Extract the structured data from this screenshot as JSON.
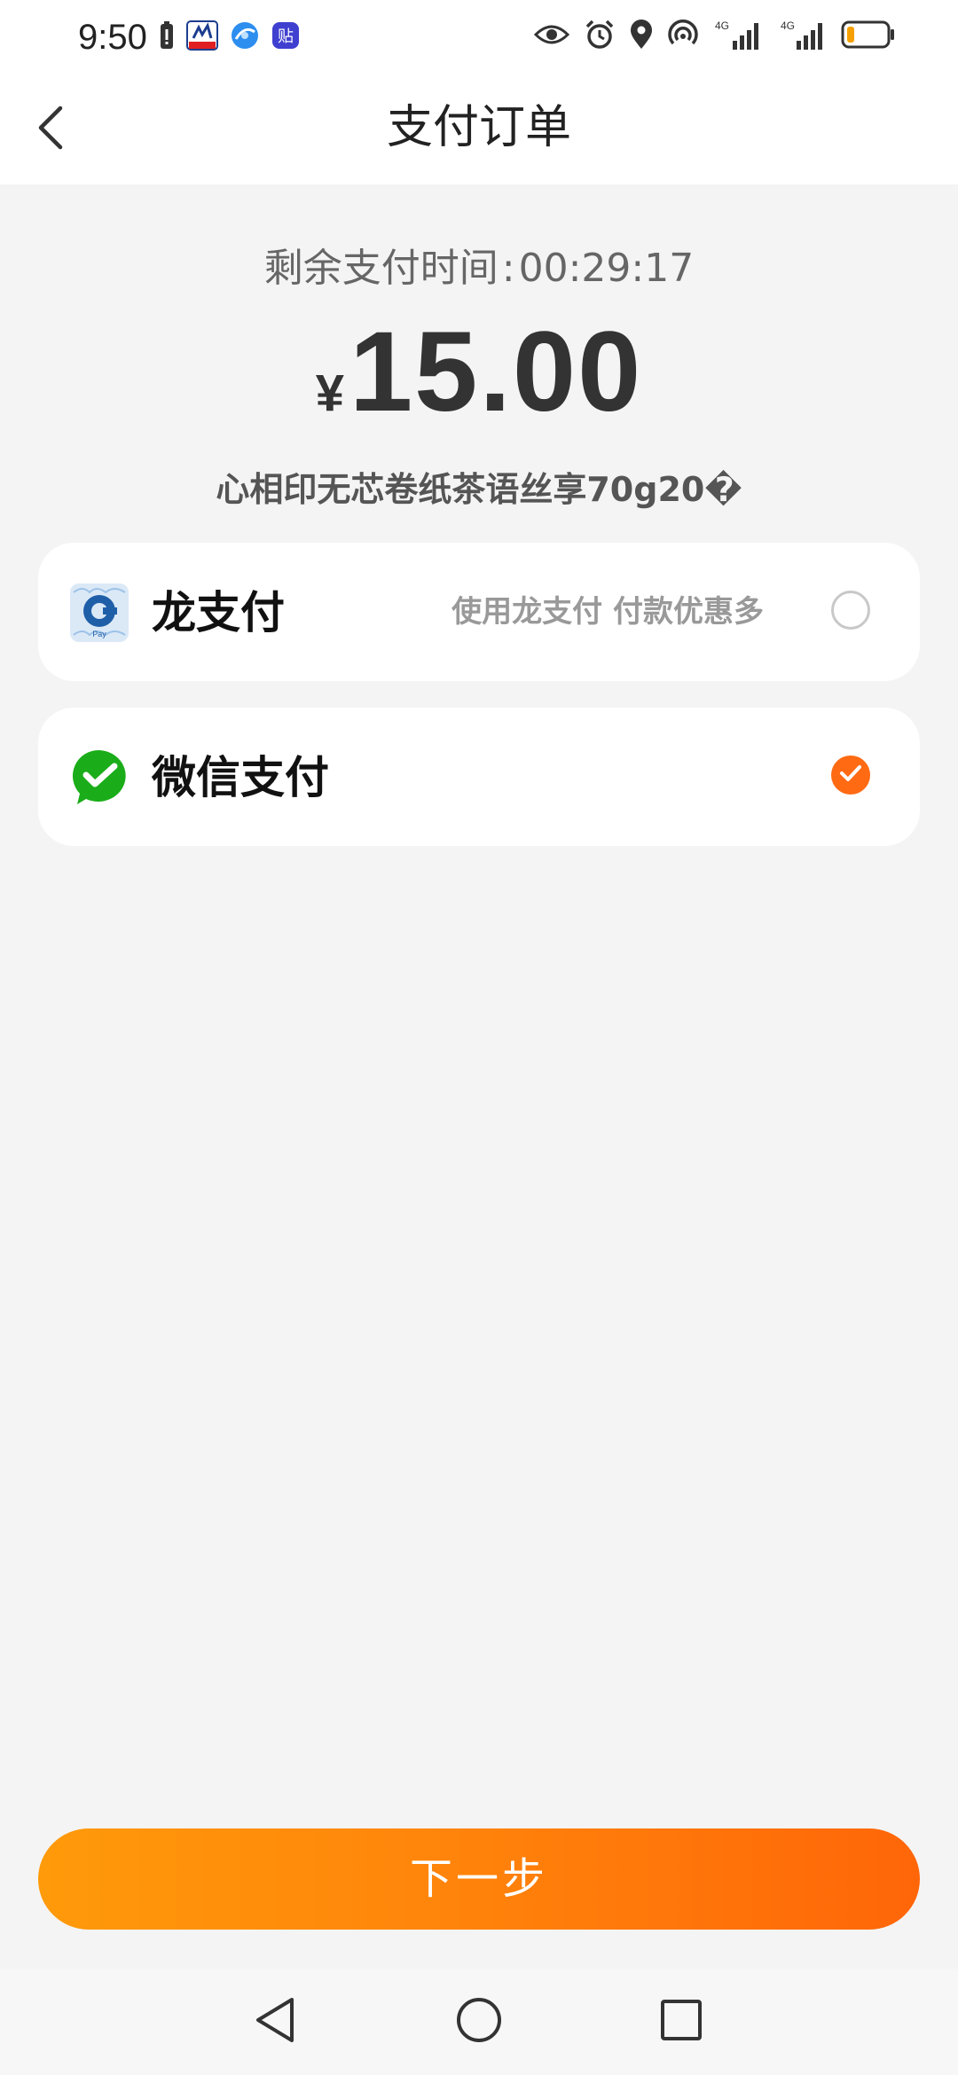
{
  "status_bar": {
    "time": "9:50",
    "left_icons": [
      "battery-saver-icon",
      "calendar-app-icon",
      "browser-app-icon",
      "tieba-app-icon"
    ],
    "right_icons": [
      "eye-icon",
      "alarm-icon",
      "location-icon",
      "hotspot-icon",
      "signal-4g-icon",
      "signal-4g-icon",
      "battery-icon"
    ],
    "signal_label_1": "4G",
    "signal_label_2": "4G",
    "battery_level": 0.2
  },
  "header": {
    "title": "支付订单",
    "back_icon": "chevron-left-icon"
  },
  "order": {
    "countdown_label": "剩余支付时间",
    "countdown_separator": ":",
    "countdown_value": "00:29:17",
    "currency": "¥",
    "amount": "15.00",
    "product_name": "心相印无芯卷纸茶语丝享70g20�"
  },
  "payment_methods": [
    {
      "icon": "ccb-pay-icon",
      "label": "龙支付",
      "hint": "使用龙支付 付款优惠多",
      "selected": false
    },
    {
      "icon": "wechat-pay-icon",
      "label": "微信支付",
      "hint": "",
      "selected": true
    }
  ],
  "footer": {
    "next_label": "下一步"
  },
  "nav_bar": {
    "icons": [
      "nav-back-icon",
      "nav-home-icon",
      "nav-recents-icon"
    ]
  },
  "colors": {
    "accent": "#ff6a13",
    "button_gradient_start": "#ff9a0a",
    "button_gradient_end": "#ff6608",
    "background": "#f4f4f4",
    "card": "#ffffff",
    "wechat_green": "#1aad19",
    "ccb_blue": "#1f5fa8"
  }
}
